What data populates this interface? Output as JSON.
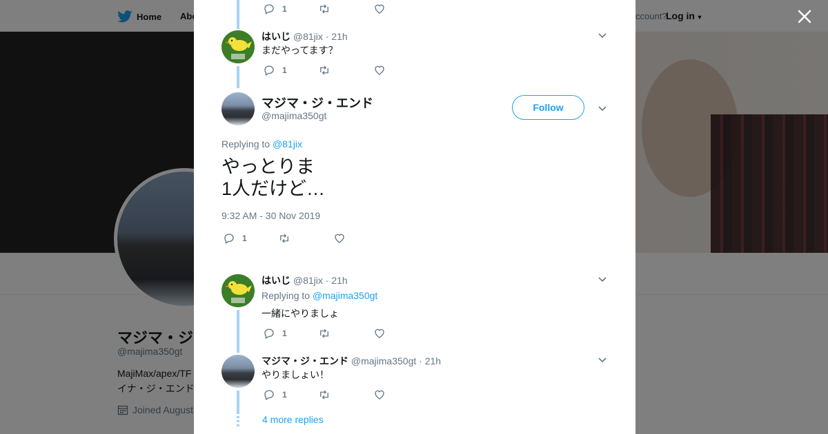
{
  "nav": {
    "home": "Home",
    "about": "Abo",
    "account_text": "ccount?",
    "login": "Log in"
  },
  "profile": {
    "name": "マジマ・ジ",
    "handle": "@majima350gt",
    "bio_line1": "MajiMax/apex/TF",
    "bio_line2": "イナ・ジ・エンド",
    "joined": "Joined August"
  },
  "tweets": {
    "t0": {
      "replies": "1"
    },
    "t1": {
      "name": "はいじ",
      "handle": "@81jix",
      "time": "· 21h",
      "text": "まだやってます？",
      "replies": "1"
    },
    "main": {
      "name": "マジマ・ジ・エンド",
      "handle": "@majima350gt",
      "follow": "Follow",
      "replying_prefix": "Replying to",
      "replying_to": "@81jix",
      "text_line1": "やっとりま",
      "text_line2": "1人だけど…",
      "timestamp": "9:32 AM - 30 Nov 2019",
      "replies": "1"
    },
    "t3": {
      "name": "はいじ",
      "handle": "@81jix",
      "time": "· 21h",
      "replying_prefix": "Replying to",
      "replying_to": "@majima350gt",
      "text": "一緒にやりましょ",
      "replies": "1"
    },
    "t4": {
      "name": "マジマ・ジ・エンド",
      "handle": "@majima350gt",
      "time": "· 21h",
      "text": "やりましょい！",
      "replies": "1"
    }
  },
  "more_replies": "4 more replies",
  "colors": {
    "accent": "#1da1f2",
    "thread_line": "#a6d4f2",
    "text": "#14171a",
    "muted": "#657786"
  }
}
